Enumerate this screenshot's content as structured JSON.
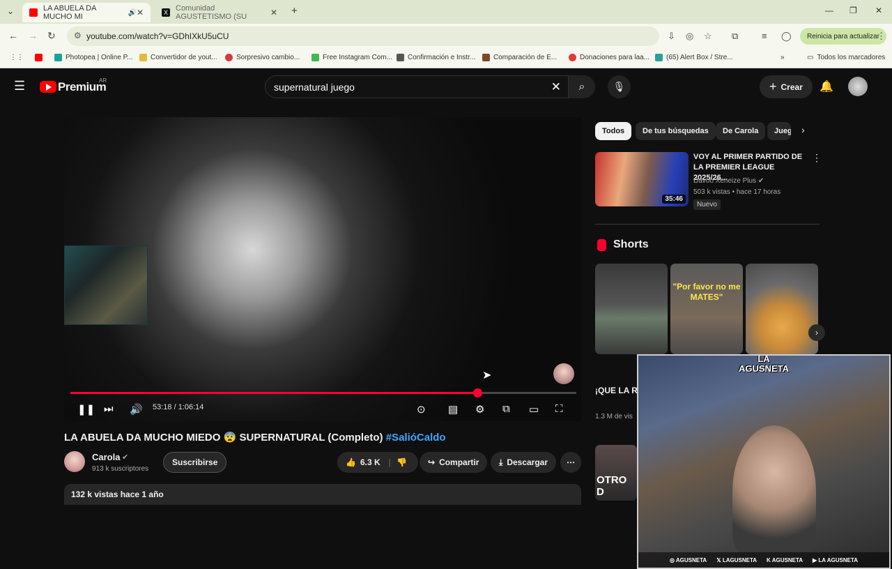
{
  "browser": {
    "tabs": [
      {
        "title": "LA ABUELA DA MUCHO MI",
        "active": true
      },
      {
        "title": "Comunidad AGUSTETISMO (SU",
        "active": false
      }
    ],
    "url": "youtube.com/watch?v=GDhIXkU5uCU",
    "update_label": "Reinicia para actualizar",
    "bookmarks": [
      "Photopea | Online P...",
      "Convertidor de yout...",
      "Sorpresivo cambio...",
      "Free Instagram Com...",
      "Confirmación e Instr...",
      "Comparación de E...",
      "Donaciones para laa...",
      "(65) Alert Box / Stre..."
    ],
    "all_bookmarks_label": "Todos los marcadores"
  },
  "header": {
    "logo_text": "Premium",
    "logo_region": "AR",
    "search_value": "supernatural juego",
    "create_label": "Crear"
  },
  "player": {
    "time_display": "53:18 / 1:06:14",
    "progress_fraction": 0.805
  },
  "video": {
    "title": "LA ABUELA DA MUCHO MIEDO 😨 SUPERNATURAL (Completo)",
    "hashtag": "#SalióCaldo",
    "channel_name": "Carola",
    "subscribers": "913 k suscriptores",
    "subscribe_label": "Suscribirse",
    "likes": "6.3 K",
    "share_label": "Compartir",
    "download_label": "Descargar",
    "views_date": "132 k vistas  hace 1 año"
  },
  "sidebar": {
    "chips": [
      "Todos",
      "De tus búsquedas",
      "De Carola",
      "Jueg"
    ],
    "recommendation": {
      "title": "VOY AL PRIMER PARTIDO DE LA PREMIER LEAGUE 2025/26...",
      "channel": "Davoo Xeneize Plus",
      "meta": "503 k vistas • hace 17 horas",
      "badge": "Nuevo",
      "duration": "35:46"
    },
    "shorts_heading": "Shorts",
    "shorts": [
      {
        "caption": "",
        "title": "¡QUE LA RECOJA T",
        "views": "1.3 M de vis"
      },
      {
        "caption": "\"Por favor no me MATES\"",
        "title": "",
        "views": ""
      },
      {
        "caption": "",
        "title": "",
        "views": ""
      }
    ],
    "next_short_title": "OTRO D"
  },
  "overlay": {
    "streamer_badge": "LA AGUSNETA",
    "socials": [
      "AGUSNETA",
      "LAGUSNETA",
      "AGUSNETA",
      "LA AGUSNETA"
    ]
  }
}
